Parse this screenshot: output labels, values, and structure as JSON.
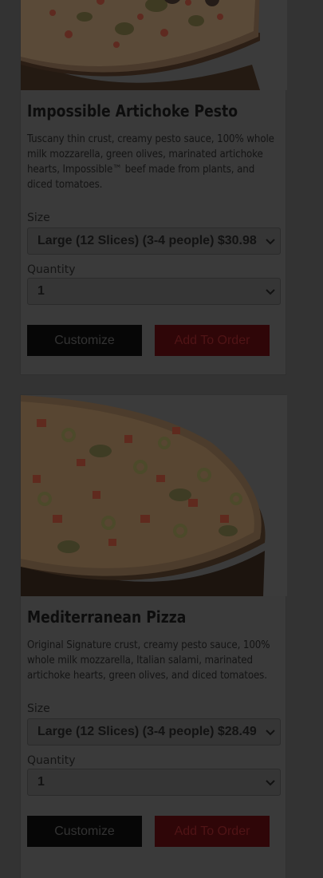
{
  "products": [
    {
      "name": "Impossible Artichoke Pesto",
      "description": "Tuscany thin crust, creamy pesto sauce, 100% whole milk mozzarella, green olives, marinated artichoke hearts, Impossible™ beef made from plants, and diced tomatoes.",
      "size_label": "Size",
      "size_value": "Large (12 Slices) (3-4 people) $30.98",
      "quantity_label": "Quantity",
      "quantity_value": "1",
      "customize_label": "Customize",
      "add_label": "Add To Order"
    },
    {
      "name": "Mediterranean Pizza",
      "description": "Original Signature crust, creamy pesto sauce, 100% whole milk mozzarella, Italian salami, marinated artichoke hearts, green olives, and diced tomatoes.",
      "size_label": "Size",
      "size_value": "Large (12 Slices) (3-4 people) $28.49",
      "quantity_label": "Quantity",
      "quantity_value": "1",
      "customize_label": "Customize",
      "add_label": "Add To Order"
    }
  ],
  "colors": {
    "page_background": "#333333",
    "card_background": "#3a3a3a",
    "customize_button": "#060606",
    "add_to_order_button": "#2f0608"
  },
  "icons": {
    "select_chevron": "chevron-down-icon"
  }
}
